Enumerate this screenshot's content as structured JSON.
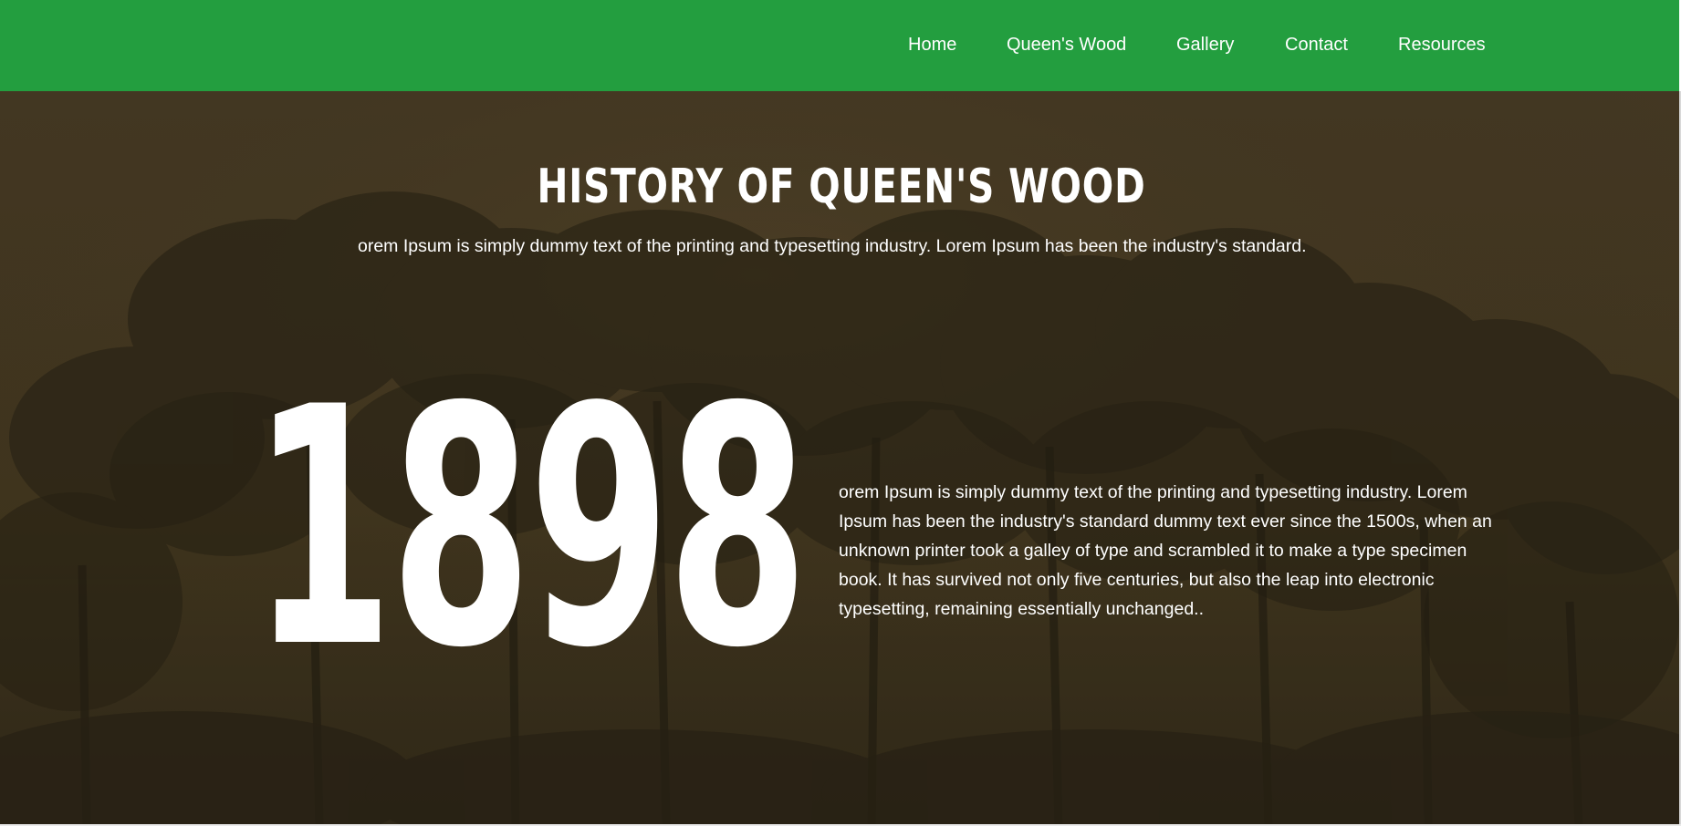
{
  "nav": {
    "items": [
      {
        "label": "Home"
      },
      {
        "label": "Queen's Wood"
      },
      {
        "label": "Gallery"
      },
      {
        "label": "Contact"
      },
      {
        "label": "Resources"
      }
    ]
  },
  "hero": {
    "title": "HISTORY OF QUEEN'S WOOD",
    "subtitle": "orem Ipsum is simply dummy text of the printing and typesetting industry. Lorem Ipsum has been the industry's standard.",
    "year": "1898",
    "body": "orem Ipsum is simply dummy text of the printing and typesetting industry. Lorem Ipsum has been the industry's standard dummy text ever since the 1500s, when an unknown printer took a galley of type and scrambled it to make a type specimen book. It has survived not only five centuries, but also the leap into electronic typesetting, remaining essentially unchanged.."
  },
  "colors": {
    "nav_background": "#239e3f",
    "hero_tint": "#3c3220",
    "text": "#ffffff"
  },
  "icons": {
    "background": "forest-tree-illustration"
  }
}
